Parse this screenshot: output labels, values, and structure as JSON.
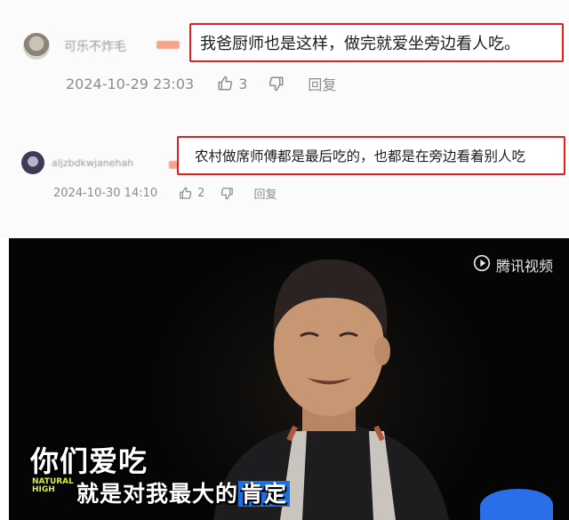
{
  "comments": [
    {
      "username": "可乐不炸毛",
      "text": "我爸厨师也是这样，做完就爱坐旁边看人吃。",
      "timestamp": "2024-10-29 23:03",
      "likes": "3",
      "reply_label": "回复"
    },
    {
      "username": "aljzbdkwjanehah",
      "text": "农村做席师傅都是最后吃的，也都是在旁边看着别人吃",
      "timestamp": "2024-10-30 14:10",
      "likes": "2",
      "reply_label": "回复"
    }
  ],
  "video": {
    "watermark": "腾讯视频",
    "subtitle_line1": "你们爱吃",
    "subtitle_line2_main": "就是对我最大的",
    "subtitle_line2_highlight": "肯定",
    "show_logo_line1": "NATURAL",
    "show_logo_line2": "HIGH"
  },
  "colors": {
    "highlight_border": "#e02020",
    "subtitle_highlight_bg": "#1c6fe0",
    "meta_text": "#8c8c8c"
  },
  "icons": {
    "like": "thumbs-up-icon",
    "dislike": "thumbs-down-icon",
    "play": "play-logo-icon"
  }
}
